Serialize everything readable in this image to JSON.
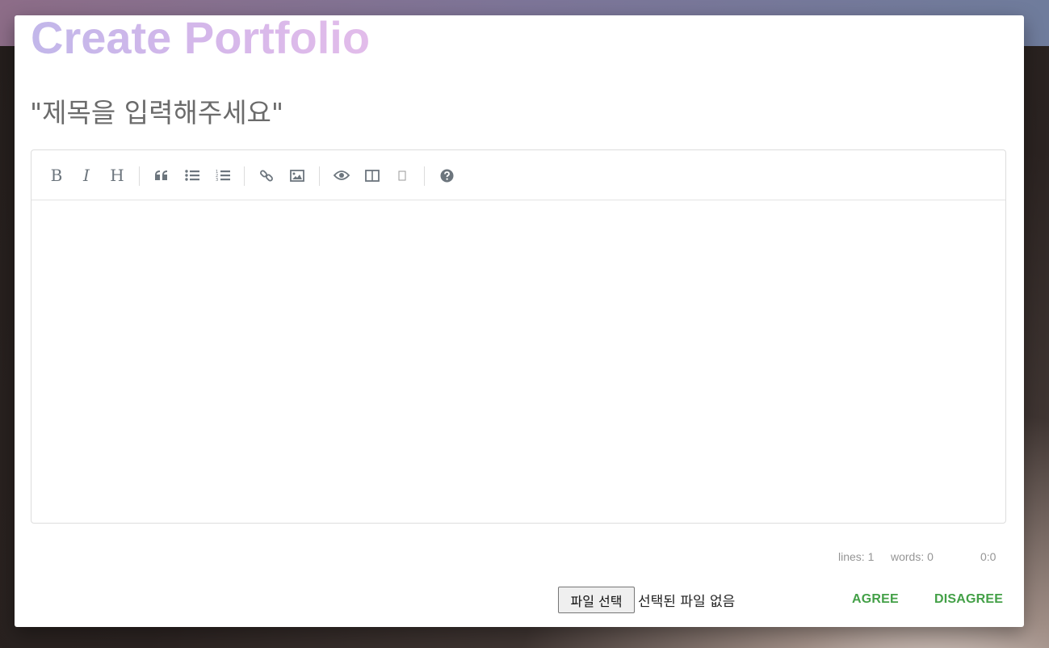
{
  "modal": {
    "title": "Create Portfolio",
    "title_input": {
      "value": "\"제목을 입력해주세요\""
    }
  },
  "editor": {
    "toolbar": [
      {
        "name": "bold",
        "label": "B",
        "icon": "bold-icon"
      },
      {
        "name": "italic",
        "label": "I",
        "icon": "italic-icon"
      },
      {
        "name": "heading",
        "label": "H",
        "icon": "heading-icon"
      },
      {
        "name": "quote",
        "icon": "quote-icon"
      },
      {
        "name": "unordered-list",
        "icon": "bullet-list-icon"
      },
      {
        "name": "ordered-list",
        "icon": "numbered-list-icon"
      },
      {
        "name": "link",
        "icon": "link-icon"
      },
      {
        "name": "image",
        "icon": "image-icon"
      },
      {
        "name": "preview",
        "icon": "eye-icon"
      },
      {
        "name": "side-by-side",
        "icon": "columns-icon"
      },
      {
        "name": "fullscreen",
        "icon": "fullscreen-icon"
      },
      {
        "name": "guide",
        "icon": "question-circle-icon"
      }
    ],
    "content": "",
    "status": {
      "lines": "lines: 1",
      "words": "words: 0",
      "cursor": "0:0"
    }
  },
  "file_input": {
    "button_label": "파일 선택",
    "status_text": "선택된 파일 없음"
  },
  "actions": {
    "agree_label": "AGREE",
    "disagree_label": "DISAGREE"
  },
  "colors": {
    "title_gradient_start": "#c2b7ea",
    "title_gradient_end": "#e2bcea",
    "action_green": "#43a047",
    "toolbar_icon": "#6c757d"
  }
}
